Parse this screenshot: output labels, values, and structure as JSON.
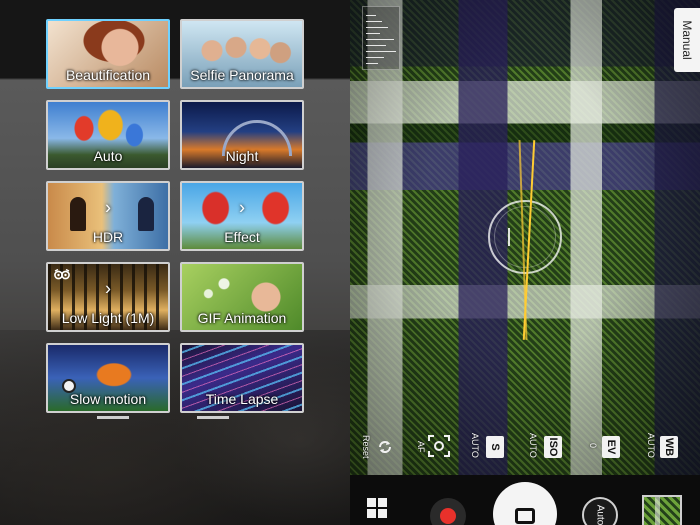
{
  "modes": [
    {
      "id": "beautification",
      "label": "Beautification",
      "selected": true
    },
    {
      "id": "selfie-panorama",
      "label": "Selfie Panorama"
    },
    {
      "id": "auto",
      "label": "Auto"
    },
    {
      "id": "night",
      "label": "Night"
    },
    {
      "id": "hdr",
      "label": "HDR"
    },
    {
      "id": "effect",
      "label": "Effect"
    },
    {
      "id": "low-light",
      "label": "Low Light (1M)"
    },
    {
      "id": "gif-animation",
      "label": "GIF Animation"
    },
    {
      "id": "slow-motion",
      "label": "Slow motion"
    },
    {
      "id": "time-lapse",
      "label": "Time Lapse"
    }
  ],
  "viewfinder": {
    "manual_label": "Manual"
  },
  "settings": {
    "reset_label": "Reset",
    "af_label": "AF",
    "shutter_value": "AUTO",
    "shutter_label": "S",
    "iso_value": "AUTO",
    "iso_label": "ISO",
    "ev_value": "0",
    "ev_label": "EV",
    "wb_value": "AUTO",
    "wb_label": "WB"
  },
  "controls": {
    "auto_label": "Auto"
  },
  "colors": {
    "selected_border": "#6fd1ff",
    "record": "#e8312b",
    "level_line": "#ffcc33"
  }
}
